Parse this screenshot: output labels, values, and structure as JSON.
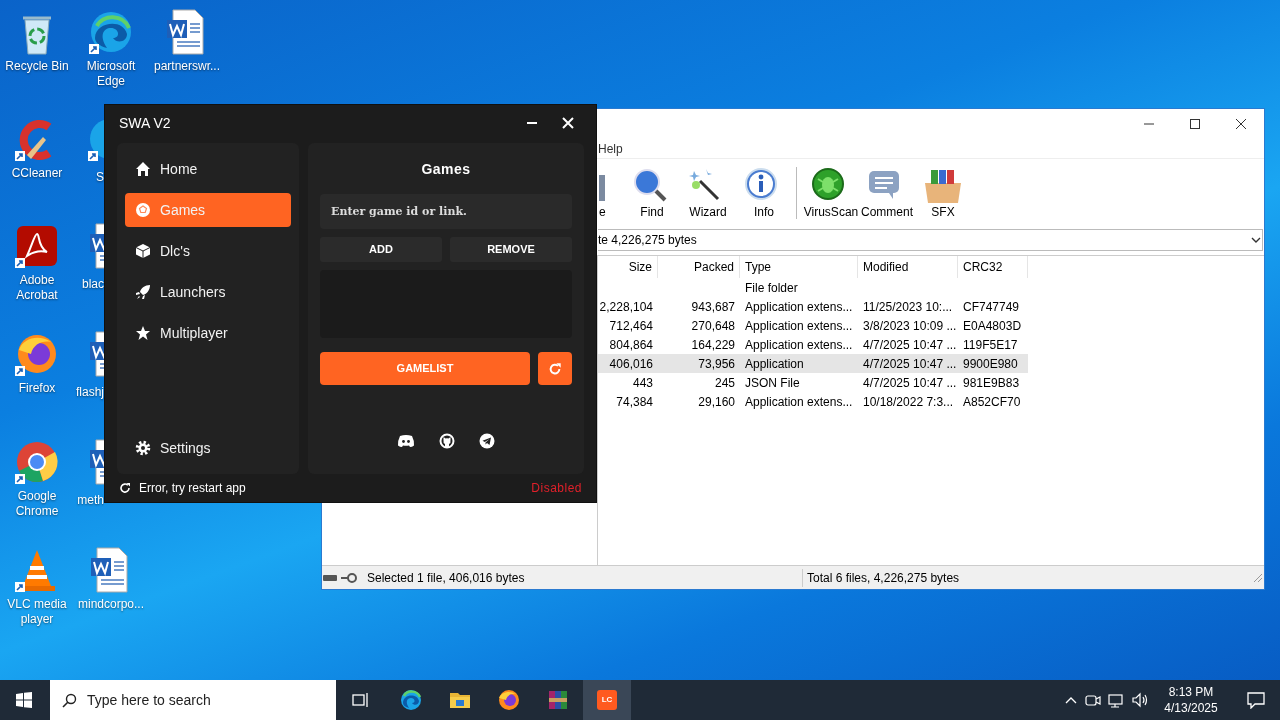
{
  "desktop_icons": [
    {
      "label": "Recycle Bin"
    },
    {
      "label": "CCleaner"
    },
    {
      "label": "Adobe Acrobat"
    },
    {
      "label": "Firefox"
    },
    {
      "label": "Google Chrome"
    },
    {
      "label": "VLC media player"
    },
    {
      "label": "Microsoft Edge"
    },
    {
      "label": "S"
    },
    {
      "label": "blac"
    },
    {
      "label": "flashj"
    },
    {
      "label": "meth"
    },
    {
      "label": "mindcorpo..."
    },
    {
      "label": "partnerswr..."
    }
  ],
  "app": {
    "title": "SWA V2",
    "nav": [
      {
        "label": "Home",
        "selected": false
      },
      {
        "label": "Games",
        "selected": true
      },
      {
        "label": "Dlc's",
        "selected": false
      },
      {
        "label": "Launchers",
        "selected": false
      },
      {
        "label": "Multiplayer",
        "selected": false
      }
    ],
    "settings": "Settings",
    "page_title": "Games",
    "game_input": {
      "placeholder": "Enter game id or link."
    },
    "buttons": [
      "ADD",
      "REMOVE"
    ],
    "gamelist_button": "GAMELIST",
    "status_text": "Error, try restart app",
    "status": "Disabled"
  },
  "archiver": {
    "menu": [
      "Help"
    ],
    "toolbar": [
      {
        "label": "e"
      },
      {
        "label": "Find"
      },
      {
        "label": "Wizard"
      },
      {
        "label": "Info"
      },
      {
        "label": "VirusScan"
      },
      {
        "label": "Comment"
      },
      {
        "label": "SFX"
      }
    ],
    "address": "te 4,226,275 bytes",
    "columns": [
      "Size",
      "Packed",
      "Type",
      "Modified",
      "CRC32"
    ],
    "rows": [
      {
        "type": "File folder",
        "selected": false
      },
      {
        "size": "2,228,104",
        "packed": "943,687",
        "type": "Application extens...",
        "modified": "11/25/2023 10:...",
        "crc32": "CF747749",
        "selected": false
      },
      {
        "size": "712,464",
        "packed": "270,648",
        "type": "Application extens...",
        "modified": "3/8/2023 10:09 ...",
        "crc32": "E0A4803D",
        "selected": false
      },
      {
        "size": "804,864",
        "packed": "164,229",
        "type": "Application extens...",
        "modified": "4/7/2025 10:47 ...",
        "crc32": "119F5E17",
        "selected": false
      },
      {
        "size": "406,016",
        "packed": "73,956",
        "type": "Application",
        "modified": "4/7/2025 10:47 ...",
        "crc32": "9900E980",
        "selected": true
      },
      {
        "size": "443",
        "packed": "245",
        "type": "JSON File",
        "modified": "4/7/2025 10:47 ...",
        "crc32": "981E9B83",
        "selected": false
      },
      {
        "size": "74,384",
        "packed": "29,160",
        "type": "Application extens...",
        "modified": "10/18/2022 7:3...",
        "crc32": "A852CF70",
        "selected": false
      }
    ],
    "status_left": "Selected 1 file, 406,016 bytes",
    "status_right": "Total 6 files, 4,226,275 bytes"
  },
  "taskbar": {
    "search_placeholder": "Type here to search",
    "apps": [
      {
        "selected": false
      },
      {
        "selected": false
      },
      {
        "selected": false
      },
      {
        "selected": false
      },
      {
        "selected": true,
        "label": "LC"
      }
    ],
    "clock": {
      "time": "8:13 PM",
      "date": "4/13/2025"
    }
  }
}
